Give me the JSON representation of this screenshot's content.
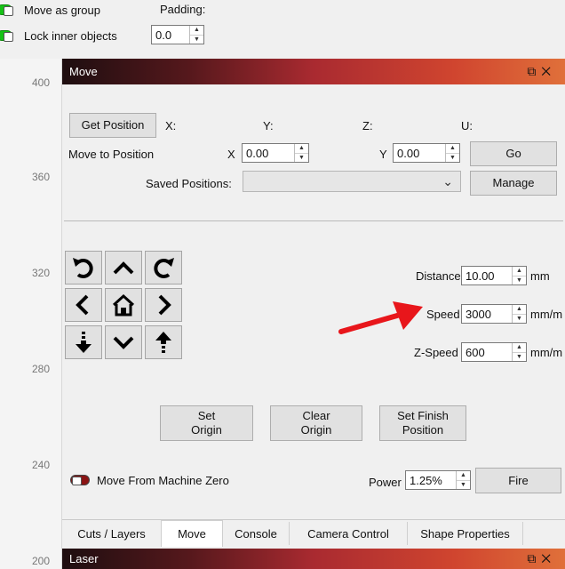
{
  "options": {
    "move_as_group": "Move as group",
    "lock_inner": "Lock inner objects",
    "padding_label": "Padding:",
    "padding_value": "0.0"
  },
  "ruler": {
    "labels": [
      "400",
      "360",
      "320",
      "280",
      "240",
      "200"
    ]
  },
  "move_panel": {
    "title": "Move",
    "get_position": "Get Position",
    "axis_x": "X:",
    "axis_y": "Y:",
    "axis_z": "Z:",
    "axis_u": "U:",
    "move_to_position": "Move to Position",
    "x_label": "X",
    "x_value": "0.00",
    "y_label": "Y",
    "y_value": "0.00",
    "go": "Go",
    "saved_positions": "Saved Positions:",
    "saved_value": "",
    "manage": "Manage",
    "distance_label": "Distance",
    "distance_value": "10.00",
    "distance_unit": "mm",
    "speed_label": "Speed",
    "speed_value": "3000",
    "speed_unit": "mm/m",
    "zspeed_label": "Z-Speed",
    "zspeed_value": "600",
    "zspeed_unit": "mm/m",
    "set_origin": "Set\nOrigin",
    "clear_origin": "Clear\nOrigin",
    "set_finish": "Set Finish\nPosition",
    "move_from_zero": "Move From Machine Zero",
    "power_label": "Power",
    "power_value": "1.25%",
    "fire": "Fire"
  },
  "tabs": [
    "Cuts / Layers",
    "Move",
    "Console",
    "Camera Control",
    "Shape Properties"
  ],
  "laser_panel": {
    "title": "Laser"
  },
  "colors": {
    "accent_arrow": "#e8161b",
    "toggle_on": "#17c317",
    "toggle_off": "#8b1414"
  }
}
